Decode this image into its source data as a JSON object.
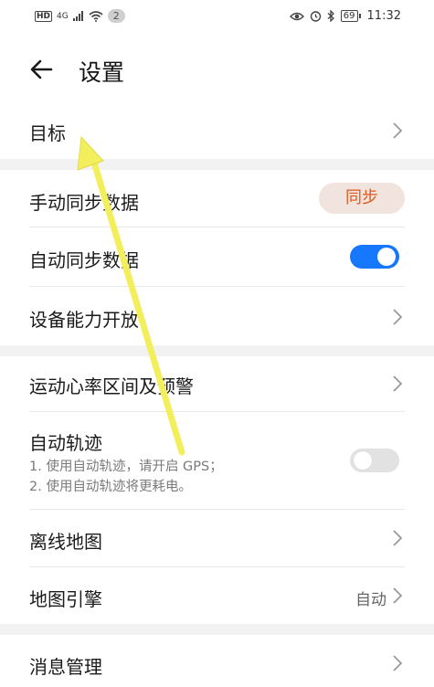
{
  "status_bar": {
    "hd": "HD",
    "signal": "4G",
    "badge": "2",
    "battery": "69",
    "time": "11:32"
  },
  "header": {
    "title": "设置",
    "back_icon": "arrow-left-icon"
  },
  "rows": {
    "goal": {
      "label": "目标"
    },
    "manual_sync": {
      "label": "手动同步数据",
      "button": "同步"
    },
    "auto_sync": {
      "label": "自动同步数据",
      "toggle_on": true
    },
    "device_capability": {
      "label": "设备能力开放"
    },
    "heart_rate": {
      "label": "运动心率区间及预警"
    },
    "auto_track": {
      "label": "自动轨迹",
      "sub1": "1. 使用自动轨迹，请开启 GPS；",
      "sub2": "2. 使用自动轨迹将更耗电。",
      "toggle_on": false
    },
    "offline_map": {
      "label": "离线地图"
    },
    "map_engine": {
      "label": "地图引擎",
      "value": "自动"
    },
    "message_mgmt": {
      "label": "消息管理"
    }
  },
  "colors": {
    "accent_blue": "#1677ff",
    "sync_text": "#e0581d",
    "sync_bg": "#f1e3dd",
    "annotation_arrow": "#f3ef5c"
  }
}
